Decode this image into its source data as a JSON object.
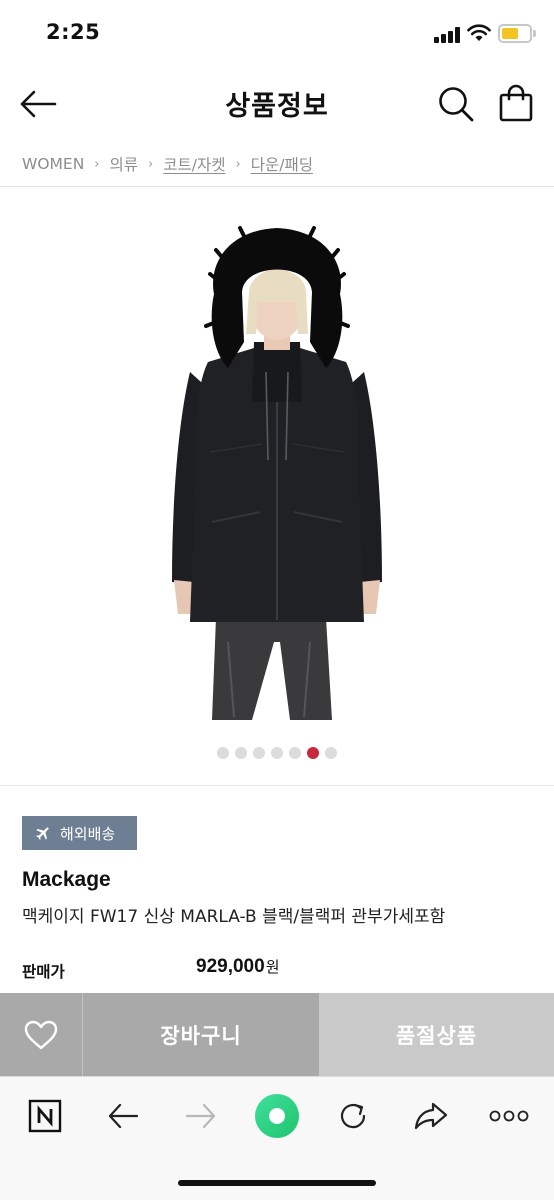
{
  "status_bar": {
    "time": "2:25",
    "battery_color": "#f3c524"
  },
  "header": {
    "title": "상품정보",
    "back_icon": "arrow-left-icon",
    "search_icon": "search-icon",
    "bag_icon": "shopping-bag-icon"
  },
  "breadcrumb": [
    {
      "label": "WOMEN"
    },
    {
      "label": "의류"
    },
    {
      "label": "코트/자켓"
    },
    {
      "label": "다운/패딩"
    }
  ],
  "gallery": {
    "image": "black-fur-hood-parka-photo",
    "total_images": 7,
    "active_index": 6,
    "active_color": "#c8283c"
  },
  "product": {
    "badge": "해외배송",
    "badge_icon": "airplane-icon",
    "badge_color": "#6e7f93",
    "brand": "Mackage",
    "name": "맥케이지 FW17 신상 MARLA-B 블랙/블랙퍼 관부가세포함",
    "price_label": "판매가",
    "price": "929,000",
    "price_unit": "원"
  },
  "actions": {
    "wish_icon": "heart-icon",
    "cart_label": "장바구니",
    "soldout_label": "품절상품"
  },
  "browser_toolbar": {
    "items": [
      "naver-n-icon",
      "back-arrow-icon",
      "forward-arrow-icon",
      "green-dot-icon",
      "refresh-icon",
      "share-icon",
      "more-dots-icon"
    ]
  }
}
